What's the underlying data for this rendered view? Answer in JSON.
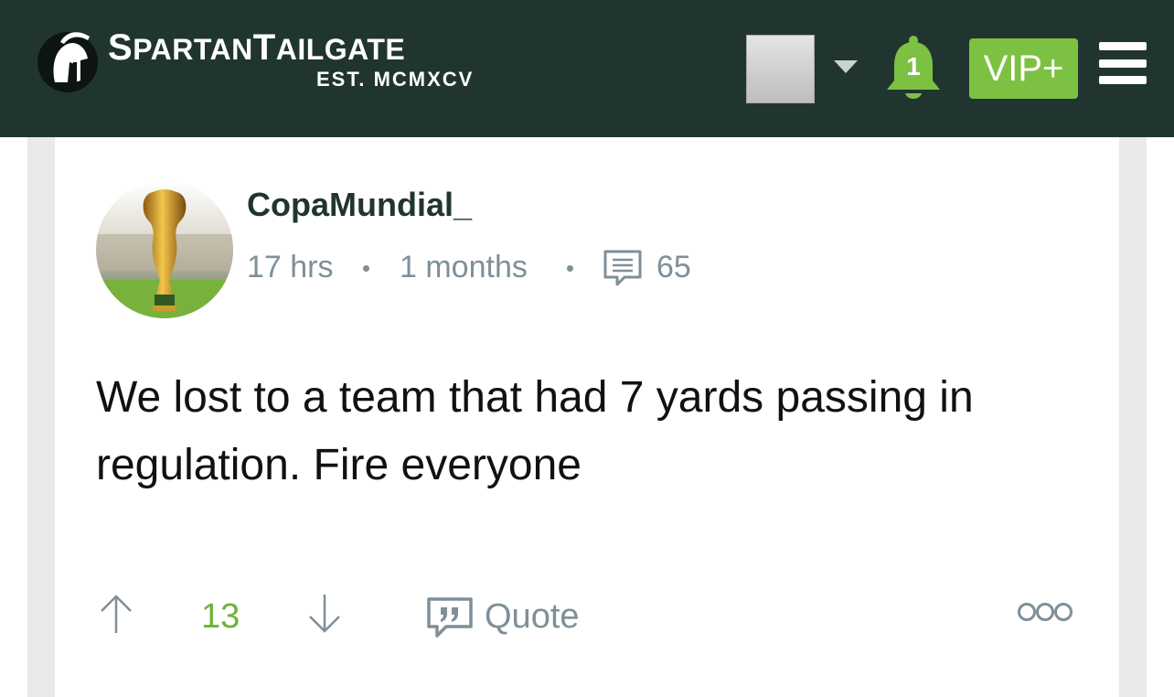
{
  "header": {
    "logo_title_part1_big": "S",
    "logo_title_part1_small": "PARTAN",
    "logo_title_part2_big": "T",
    "logo_title_part2_small": "AILGATE",
    "logo_subtitle": "EST. MCMXCV",
    "notification_count": "1",
    "vip_label": "VIP+",
    "colors": {
      "bar": "#213530",
      "accent": "#7dc143"
    }
  },
  "post": {
    "author": "CopaMundial_",
    "posted_ago": "17 hrs",
    "member_for": "1 months",
    "comment_count": "65",
    "body": "We lost to a team that had 7 yards passing in regulation. Fire everyone",
    "vote_score": "13",
    "quote_label": "Quote",
    "more_label": "ooo"
  }
}
